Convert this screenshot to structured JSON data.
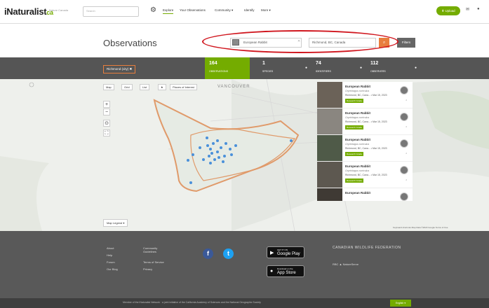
{
  "nav": {
    "logo": "iNaturalist",
    "logo_suffix": "ca",
    "logo_sub": "Nature Canada",
    "search_placeholder": "Search",
    "links": [
      "Explore",
      "Your Observations",
      "Community ▾",
      "Identify",
      "More ▾"
    ],
    "upload_label": "⬆ Upload",
    "icons": [
      "gear-icon",
      "mail-icon",
      "notification-icon"
    ]
  },
  "header": {
    "title": "Observations",
    "taxon_value": "European Rabbit",
    "place_value": "Richmond, BC, Canada",
    "go_label": "Go",
    "filters_label": "Filters"
  },
  "stats": {
    "place_tag": "Richmond (city) ✖",
    "observations": {
      "count": "164",
      "label": "OBSERVATIONS"
    },
    "species": {
      "count": "1",
      "label": "SPECIES"
    },
    "identifications": {
      "count": "74",
      "label": "IDENTIFIERS"
    },
    "observers": {
      "count": "112",
      "label": "OBSERVERS"
    }
  },
  "map": {
    "tabs": [
      "Map",
      "Grid",
      "List",
      "★",
      "Places of Interest"
    ],
    "city_label": "VANCOUVER",
    "legend_label": "Map Legend ▾",
    "attribution": "Keyboard shortcuts   Map Data ©2023 Google   Terms of Use"
  },
  "observations": [
    {
      "name": "European Rabbit",
      "sci": "Oryctolagus cuniculus",
      "place": "Richmond, BC, Cana... • Mar 15, 2023",
      "grade": "Research Grade",
      "count": "2"
    },
    {
      "name": "European Rabbit",
      "sci": "Oryctolagus cuniculus",
      "place": "Richmond, BC, Cana... • Mar 15, 2023",
      "grade": "Research Grade",
      "count": "2"
    },
    {
      "name": "European Rabbit",
      "sci": "Oryctolagus cuniculus",
      "place": "Richmond, BC, Cana... • Mar 15, 2023",
      "grade": "Research Grade",
      "count": "2"
    },
    {
      "name": "European Rabbit",
      "sci": "Oryctolagus cuniculus",
      "place": "Richmond, BC, Cana... • Mar 15, 2023",
      "grade": "Research Grade",
      "count": "2"
    },
    {
      "name": "European Rabbit",
      "sci": "",
      "place": "",
      "grade": "",
      "count": ""
    }
  ],
  "footer": {
    "col1": [
      "About",
      "Help",
      "Forum",
      "Our Blog"
    ],
    "col2": [
      "Community Guidelines",
      "Terms of Service",
      "Privacy"
    ],
    "google_play": {
      "small": "GET IT ON",
      "big": "Google Play"
    },
    "app_store": {
      "small": "Download on the",
      "big": "App Store"
    },
    "federation": "CANADIAN WILDLIFE FEDERATION",
    "partners": "RBC  ▲  NatureServe"
  },
  "bottom": {
    "text": "Member of the iNaturalist Network  ·  a joint initiative of the California Academy of Sciences and the National Geographic Society",
    "language": "English ▾"
  },
  "colors": {
    "brand": "#74ac00",
    "accent": "#e87e3d",
    "highlight": "#d0161e"
  }
}
